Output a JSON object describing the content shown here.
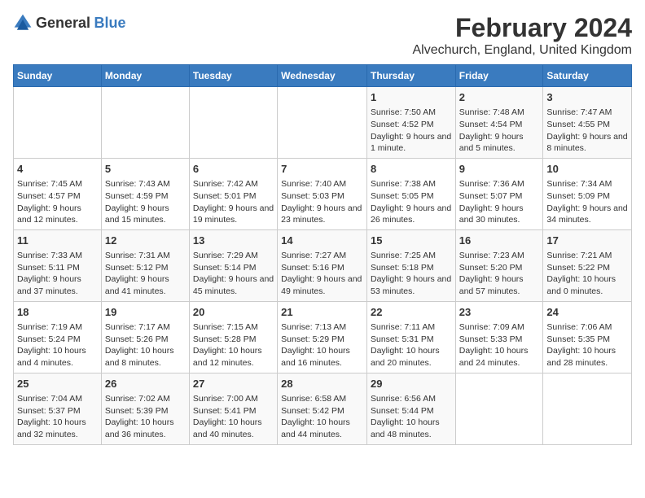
{
  "header": {
    "logo_general": "General",
    "logo_blue": "Blue",
    "month_year": "February 2024",
    "location": "Alvechurch, England, United Kingdom"
  },
  "days_of_week": [
    "Sunday",
    "Monday",
    "Tuesday",
    "Wednesday",
    "Thursday",
    "Friday",
    "Saturday"
  ],
  "weeks": [
    [
      {
        "day": "",
        "content": ""
      },
      {
        "day": "",
        "content": ""
      },
      {
        "day": "",
        "content": ""
      },
      {
        "day": "",
        "content": ""
      },
      {
        "day": "1",
        "content": "Sunrise: 7:50 AM\nSunset: 4:52 PM\nDaylight: 9 hours and 1 minute."
      },
      {
        "day": "2",
        "content": "Sunrise: 7:48 AM\nSunset: 4:54 PM\nDaylight: 9 hours and 5 minutes."
      },
      {
        "day": "3",
        "content": "Sunrise: 7:47 AM\nSunset: 4:55 PM\nDaylight: 9 hours and 8 minutes."
      }
    ],
    [
      {
        "day": "4",
        "content": "Sunrise: 7:45 AM\nSunset: 4:57 PM\nDaylight: 9 hours and 12 minutes."
      },
      {
        "day": "5",
        "content": "Sunrise: 7:43 AM\nSunset: 4:59 PM\nDaylight: 9 hours and 15 minutes."
      },
      {
        "day": "6",
        "content": "Sunrise: 7:42 AM\nSunset: 5:01 PM\nDaylight: 9 hours and 19 minutes."
      },
      {
        "day": "7",
        "content": "Sunrise: 7:40 AM\nSunset: 5:03 PM\nDaylight: 9 hours and 23 minutes."
      },
      {
        "day": "8",
        "content": "Sunrise: 7:38 AM\nSunset: 5:05 PM\nDaylight: 9 hours and 26 minutes."
      },
      {
        "day": "9",
        "content": "Sunrise: 7:36 AM\nSunset: 5:07 PM\nDaylight: 9 hours and 30 minutes."
      },
      {
        "day": "10",
        "content": "Sunrise: 7:34 AM\nSunset: 5:09 PM\nDaylight: 9 hours and 34 minutes."
      }
    ],
    [
      {
        "day": "11",
        "content": "Sunrise: 7:33 AM\nSunset: 5:11 PM\nDaylight: 9 hours and 37 minutes."
      },
      {
        "day": "12",
        "content": "Sunrise: 7:31 AM\nSunset: 5:12 PM\nDaylight: 9 hours and 41 minutes."
      },
      {
        "day": "13",
        "content": "Sunrise: 7:29 AM\nSunset: 5:14 PM\nDaylight: 9 hours and 45 minutes."
      },
      {
        "day": "14",
        "content": "Sunrise: 7:27 AM\nSunset: 5:16 PM\nDaylight: 9 hours and 49 minutes."
      },
      {
        "day": "15",
        "content": "Sunrise: 7:25 AM\nSunset: 5:18 PM\nDaylight: 9 hours and 53 minutes."
      },
      {
        "day": "16",
        "content": "Sunrise: 7:23 AM\nSunset: 5:20 PM\nDaylight: 9 hours and 57 minutes."
      },
      {
        "day": "17",
        "content": "Sunrise: 7:21 AM\nSunset: 5:22 PM\nDaylight: 10 hours and 0 minutes."
      }
    ],
    [
      {
        "day": "18",
        "content": "Sunrise: 7:19 AM\nSunset: 5:24 PM\nDaylight: 10 hours and 4 minutes."
      },
      {
        "day": "19",
        "content": "Sunrise: 7:17 AM\nSunset: 5:26 PM\nDaylight: 10 hours and 8 minutes."
      },
      {
        "day": "20",
        "content": "Sunrise: 7:15 AM\nSunset: 5:28 PM\nDaylight: 10 hours and 12 minutes."
      },
      {
        "day": "21",
        "content": "Sunrise: 7:13 AM\nSunset: 5:29 PM\nDaylight: 10 hours and 16 minutes."
      },
      {
        "day": "22",
        "content": "Sunrise: 7:11 AM\nSunset: 5:31 PM\nDaylight: 10 hours and 20 minutes."
      },
      {
        "day": "23",
        "content": "Sunrise: 7:09 AM\nSunset: 5:33 PM\nDaylight: 10 hours and 24 minutes."
      },
      {
        "day": "24",
        "content": "Sunrise: 7:06 AM\nSunset: 5:35 PM\nDaylight: 10 hours and 28 minutes."
      }
    ],
    [
      {
        "day": "25",
        "content": "Sunrise: 7:04 AM\nSunset: 5:37 PM\nDaylight: 10 hours and 32 minutes."
      },
      {
        "day": "26",
        "content": "Sunrise: 7:02 AM\nSunset: 5:39 PM\nDaylight: 10 hours and 36 minutes."
      },
      {
        "day": "27",
        "content": "Sunrise: 7:00 AM\nSunset: 5:41 PM\nDaylight: 10 hours and 40 minutes."
      },
      {
        "day": "28",
        "content": "Sunrise: 6:58 AM\nSunset: 5:42 PM\nDaylight: 10 hours and 44 minutes."
      },
      {
        "day": "29",
        "content": "Sunrise: 6:56 AM\nSunset: 5:44 PM\nDaylight: 10 hours and 48 minutes."
      },
      {
        "day": "",
        "content": ""
      },
      {
        "day": "",
        "content": ""
      }
    ]
  ]
}
